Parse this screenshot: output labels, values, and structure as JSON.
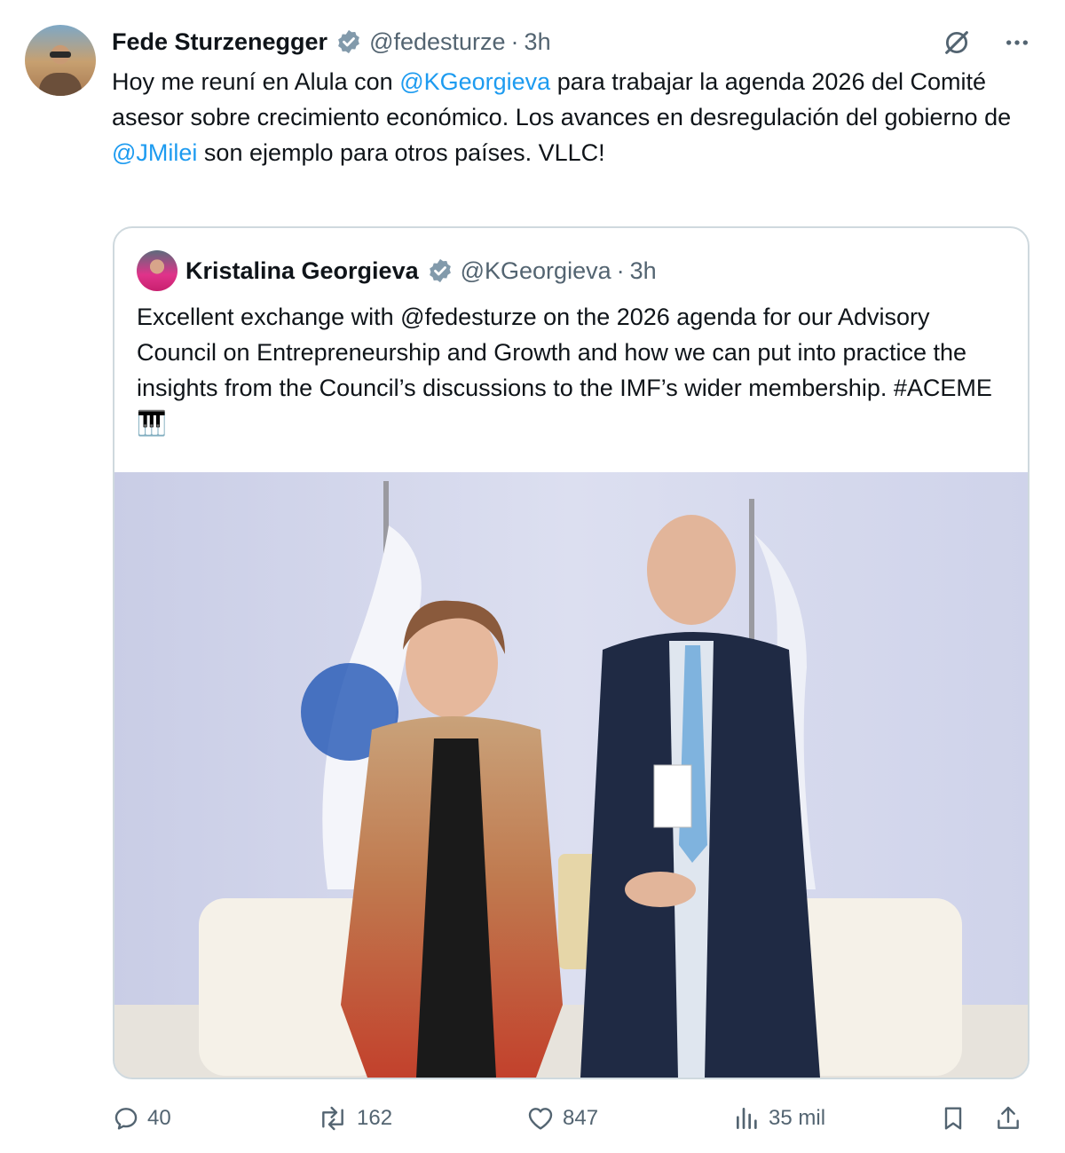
{
  "tweet": {
    "author_name": "Fede Sturzenegger",
    "author_handle": "@fedesturze",
    "separator": "·",
    "time": "3h",
    "text_1": "Hoy me reuní en Alula con ",
    "mention_1": "@KGeorgieva",
    "text_2": " para trabajar la agenda 2026 del Comité asesor sobre crecimiento económico. Los avances en desregulación del gobierno de ",
    "mention_2": "@JMilei",
    "text_3": " son ejemplo para otros países. VLLC!"
  },
  "quote": {
    "author_name": "Kristalina Georgieva",
    "author_handle": "@KGeorgieva",
    "separator": "·",
    "time": "3h",
    "text": "Excellent exchange with @fedesturze on the 2026 agenda for our Advisory Council on Entrepreneurship and Growth and how we can put into practice the insights from the Council’s discussions to the IMF’s wider membership. #ACEME 🎹"
  },
  "actions": {
    "replies": "40",
    "reposts": "162",
    "likes": "847",
    "views": "35 mil"
  },
  "colors": {
    "accent": "#1d9bf0",
    "muted": "#536471",
    "border": "#cfd9de"
  },
  "icons": [
    "verified-badge-icon",
    "grok-icon",
    "more-icon",
    "reply-icon",
    "repost-icon",
    "like-icon",
    "views-icon",
    "bookmark-icon",
    "share-icon"
  ]
}
